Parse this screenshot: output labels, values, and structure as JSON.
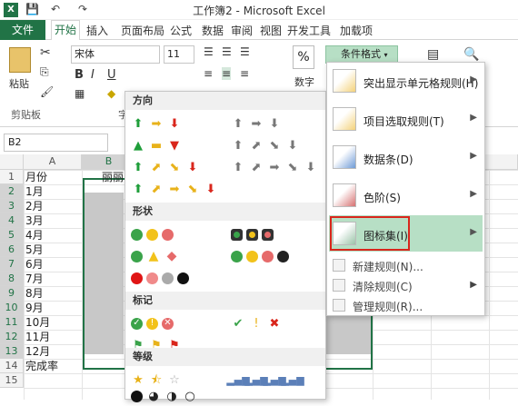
{
  "window": {
    "title": "工作簿2 - Microsoft Excel",
    "app_icon": "X"
  },
  "quick_access": {
    "save": "💾",
    "undo": "↶",
    "redo": "↷"
  },
  "ribbon_tabs": {
    "file": "文件",
    "start": "开始",
    "insert": "插入",
    "layout": "页面布局",
    "formula": "公式",
    "data": "数据",
    "review": "审阅",
    "view": "视图",
    "dev": "开发工具",
    "addins": "加载项"
  },
  "ribbon": {
    "paste": "粘贴",
    "clipboard": "剪贴板",
    "font_name": "宋体",
    "font_size": "11",
    "bold": "B",
    "italic": "I",
    "underline": "U",
    "percent": "%",
    "number": "数字",
    "cond_format": "条件格式",
    "font_group_partial": "字"
  },
  "formula_bar": {
    "name_box": "B2"
  },
  "grid": {
    "col_a": "A",
    "col_b": "B",
    "b1": "丽丽",
    "rows": [
      "1",
      "2",
      "3",
      "4",
      "5",
      "6",
      "7",
      "8",
      "9",
      "10",
      "11",
      "12",
      "13",
      "14",
      "15"
    ],
    "a_values": [
      "月份",
      "1月",
      "2月",
      "3月",
      "4月",
      "5月",
      "6月",
      "7月",
      "8月",
      "9月",
      "10月",
      "11月",
      "12月",
      "完成率"
    ]
  },
  "icon_panel": {
    "sections": {
      "direction": "方向",
      "shape": "形状",
      "mark": "标记",
      "rating": "等级"
    }
  },
  "menu": {
    "items": [
      {
        "label": "突出显示单元格规则(H)",
        "has_arrow": true
      },
      {
        "label": "项目选取规则(T)",
        "has_arrow": true
      },
      {
        "label": "数据条(D)",
        "has_arrow": true
      },
      {
        "label": "色阶(S)",
        "has_arrow": true
      },
      {
        "label": "图标集(I)",
        "has_arrow": true
      }
    ],
    "small_items": [
      {
        "label": "新建规则(N)...",
        "has_arrow": false
      },
      {
        "label": "清除规则(C)",
        "has_arrow": true
      },
      {
        "label": "管理规则(R)...",
        "has_arrow": false
      }
    ]
  },
  "colors": {
    "excel_green": "#217346",
    "highlight": "#b7dfc5",
    "red_box": "#d9261c"
  }
}
